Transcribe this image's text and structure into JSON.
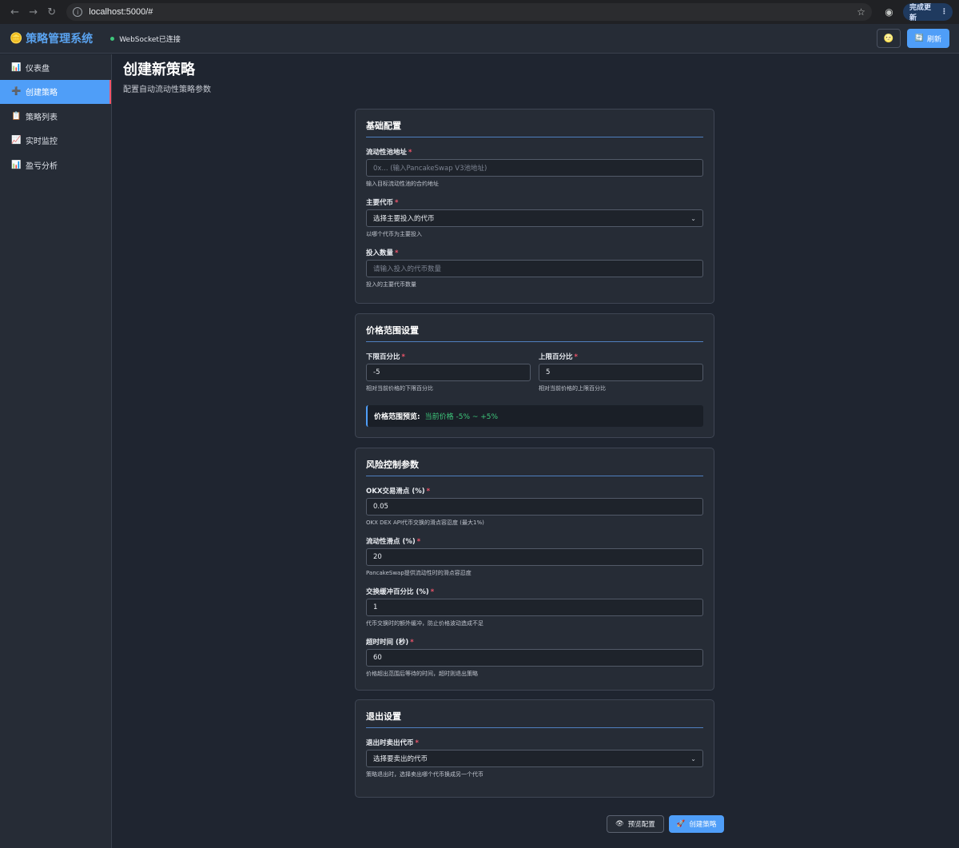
{
  "browser": {
    "url": "localhost:5000/#",
    "update_label": "完成更新"
  },
  "header": {
    "brand": "策略管理系统",
    "ws_status": "WebSocket已连接",
    "refresh_label": "刷新"
  },
  "sidebar": {
    "items": [
      {
        "icon": "📊",
        "label": "仪表盘"
      },
      {
        "icon": "➕",
        "label": "创建策略"
      },
      {
        "icon": "📋",
        "label": "策略列表"
      },
      {
        "icon": "📈",
        "label": "实时监控"
      },
      {
        "icon": "📊",
        "label": "盈亏分析"
      }
    ]
  },
  "page": {
    "title": "创建新策略",
    "subtitle": "配置自动流动性策略参数"
  },
  "basic": {
    "title": "基础配置",
    "pool_label": "流动性池地址",
    "pool_placeholder": "0x... (输入PancakeSwap V3池地址)",
    "pool_help": "输入目标流动性池的合约地址",
    "token_label": "主要代币",
    "token_value": "选择主要投入的代币",
    "token_help": "以哪个代币为主要投入",
    "amount_label": "投入数量",
    "amount_placeholder": "请输入投入的代币数量",
    "amount_help": "投入的主要代币数量"
  },
  "range": {
    "title": "价格范围设置",
    "lower_label": "下限百分比",
    "lower_value": "-5",
    "lower_help": "相对当前价格的下限百分比",
    "upper_label": "上限百分比",
    "upper_value": "5",
    "upper_help": "相对当前价格的上限百分比",
    "preview_label": "价格范围预览:",
    "preview_value": "当前价格 -5% ~ +5%"
  },
  "risk": {
    "title": "风险控制参数",
    "okx_label": "OKX交易滑点 (%)",
    "okx_value": "0.05",
    "okx_help": "OKX DEX API代币交换的滑点容忍度 (最大1%)",
    "liq_label": "流动性滑点 (%)",
    "liq_value": "20",
    "liq_help": "PancakeSwap提供流动性时的滑点容忍度",
    "buffer_label": "交换缓冲百分比 (%)",
    "buffer_value": "1",
    "buffer_help": "代币交换时的额外缓冲，防止价格波动造成不足",
    "timeout_label": "超时时间 (秒)",
    "timeout_value": "60",
    "timeout_help": "价格超出范围后等待的时间，超时则退出策略"
  },
  "exit": {
    "title": "退出设置",
    "sell_label": "退出时卖出代币",
    "sell_value": "选择要卖出的代币",
    "sell_help": "策略退出时，选择卖出哪个代币换成另一个代币"
  },
  "actions": {
    "preview_label": "预览配置",
    "create_label": "创建策略"
  },
  "colors": {
    "accent": "#4f9ef8",
    "success": "#3ec77b",
    "required": "#f0556b"
  }
}
